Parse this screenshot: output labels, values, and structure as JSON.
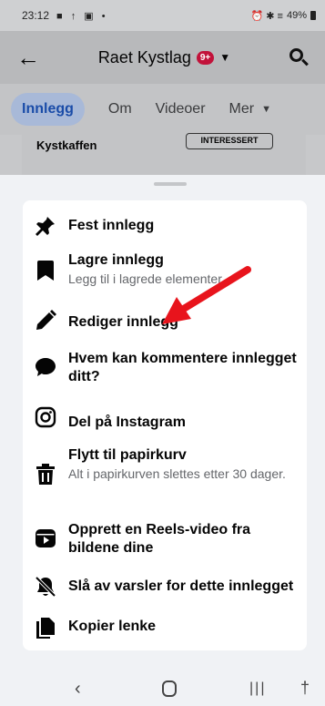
{
  "status_bar": {
    "time": "23:12",
    "left_icons": "■ ↑ ▣ •",
    "right_icons": "⏰ ✱ ≡",
    "battery": "49%"
  },
  "header": {
    "back_icon": "arrow-left",
    "title": "Raet Kystlag",
    "badge": "9+",
    "caret": "▼",
    "search_icon": "search"
  },
  "tabs": {
    "items": [
      "Innlegg",
      "Om",
      "Videoer",
      "Mer"
    ],
    "active": "Innlegg",
    "more_caret": "▼"
  },
  "background_card": {
    "name": "Kystkaffen",
    "button": "INTERESSERT"
  },
  "menu": {
    "items": [
      {
        "icon": "pin-icon",
        "label": "Fest innlegg",
        "sub": ""
      },
      {
        "icon": "bookmark-icon",
        "label": "Lagre innlegg",
        "sub": "Legg til i lagrede elementer."
      },
      {
        "icon": "pencil-icon",
        "label": "Rediger innlegg",
        "sub": ""
      },
      {
        "icon": "comment-icon",
        "label": "Hvem kan kommentere innlegget ditt?",
        "sub": ""
      },
      {
        "icon": "instagram-icon",
        "label": "Del på Instagram",
        "sub": ""
      },
      {
        "icon": "trash-icon",
        "label": "Flytt til papirkurv",
        "sub": "Alt i papirkurven slettes etter 30 dager."
      },
      {
        "icon": "reels-icon",
        "label": "Opprett en Reels-video fra bildene dine",
        "sub": ""
      },
      {
        "icon": "bell-off-icon",
        "label": "Slå av varsler for dette innlegget",
        "sub": ""
      },
      {
        "icon": "copy-link-icon",
        "label": "Kopier lenke",
        "sub": ""
      }
    ]
  },
  "nav_bar": {
    "back": "‹",
    "recent": "|||",
    "accessibility": "†"
  },
  "colors": {
    "accent": "#1877f2",
    "annotation_arrow": "#e8141c"
  }
}
